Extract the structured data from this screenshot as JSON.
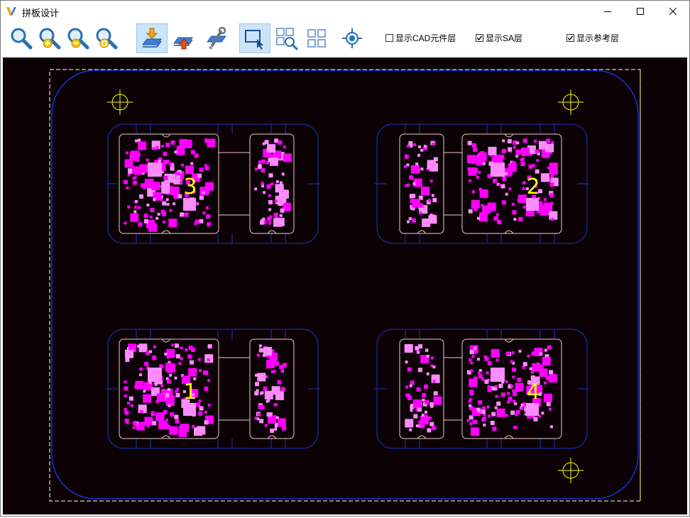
{
  "window": {
    "title": "拼板设计",
    "app_icon": "v-logo-icon",
    "controls": [
      "minimize-icon",
      "maximize-icon",
      "close-icon"
    ]
  },
  "toolbar": {
    "buttons": [
      {
        "name": "zoom-icon",
        "active": false
      },
      {
        "name": "zoom-in-icon",
        "active": false
      },
      {
        "name": "zoom-out-icon",
        "active": false
      },
      {
        "name": "zoom-fit-icon",
        "active": false
      },
      {
        "name": "import-icon",
        "active": true
      },
      {
        "name": "export-icon",
        "active": false
      },
      {
        "name": "settings-wrench-icon",
        "active": false
      },
      {
        "name": "select-icon",
        "active": true
      },
      {
        "name": "grid-search-icon",
        "active": false
      },
      {
        "name": "grid-icon",
        "active": false
      },
      {
        "name": "target-icon",
        "active": false
      }
    ],
    "checkboxes": [
      {
        "label": "显示CAD元件层",
        "checked": false
      },
      {
        "label": "显示SA层",
        "checked": true
      },
      {
        "label": "显示参考层",
        "checked": true
      }
    ]
  },
  "canvas": {
    "boards": [
      {
        "number": "3"
      },
      {
        "number": "2"
      },
      {
        "number": "1"
      },
      {
        "number": "4"
      }
    ],
    "colors": {
      "background": "#0c0205",
      "outline_blue": "#1e3cff",
      "fixture_outline": "#1a32c8",
      "board_outline": "#f0c8c8",
      "pads": "#ff00ff",
      "light_pads": "#ff8cff",
      "labels": "#ffff00",
      "dashed_border": "#ffffff"
    }
  }
}
